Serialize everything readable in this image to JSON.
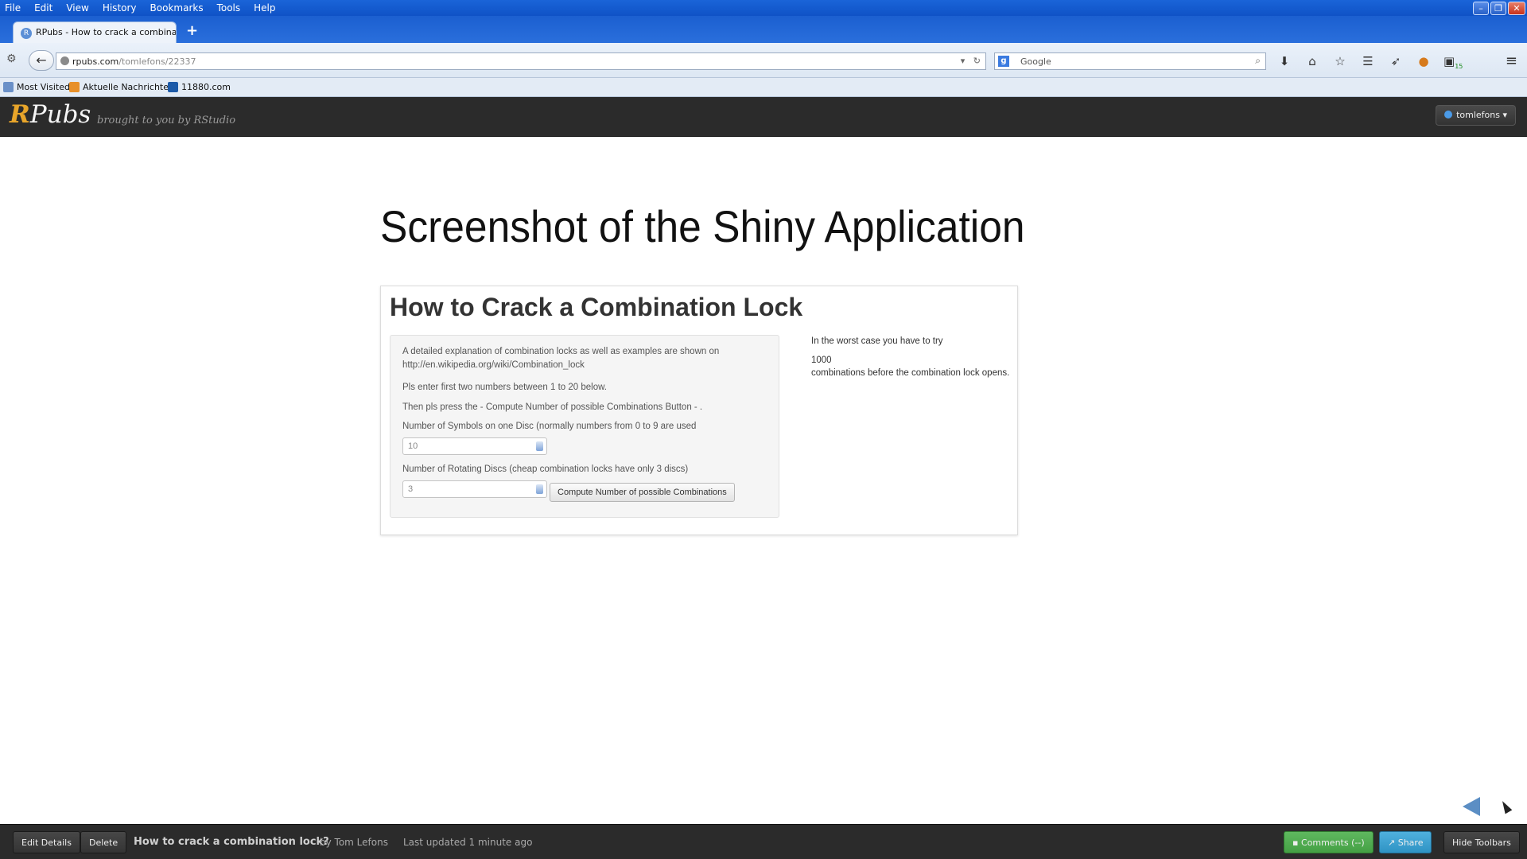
{
  "browser": {
    "menu": [
      "File",
      "Edit",
      "View",
      "History",
      "Bookmarks",
      "Tools",
      "Help"
    ],
    "tab_title": "RPubs - How to crack a combinati...",
    "url_host": "rpubs.com",
    "url_path": "/tomlefons/22337",
    "search_placeholder": "Google",
    "bookmarks": [
      "Most Visited",
      "Aktuelle Nachrichten",
      "11880.com"
    ],
    "badge": "15"
  },
  "rpubs": {
    "logo_r": "R",
    "logo_rest": "Pubs",
    "tagline": "brought to you by RStudio",
    "user": "tomlefons"
  },
  "main": {
    "title": "Screenshot of the Shiny Application",
    "app": {
      "title": "How to Crack a Combination Lock",
      "intro_line1": "A detailed explanation of combination locks as well as examples are shown on",
      "intro_line2": "http://en.wikipedia.org/wiki/Combination_lock",
      "instruction1": "Pls enter first two numbers between 1 to 20 below.",
      "instruction2": "Then pls press the - Compute Number of possible Combinations Button - .",
      "symbols_label": "Number of Symbols on one Disc (normally numbers from 0 to 9 are used",
      "symbols_value": "10",
      "discs_label": "Number of Rotating Discs (cheap combination locks have only 3 discs)",
      "discs_value": "3",
      "compute_label": "Compute Number of possible Combinations",
      "result_intro": "In the worst case you have to try",
      "result_value": "1000",
      "result_outro": "combinations before the combination lock opens."
    }
  },
  "bottom": {
    "edit_label": "Edit Details",
    "delete_label": "Delete",
    "doc_title": "How to crack a combination lock?",
    "author": "by Tom Lefons",
    "updated": "Last updated 1 minute ago",
    "comments_label": "Comments (--)",
    "share_label": "Share",
    "hide_label": "Hide Toolbars"
  }
}
